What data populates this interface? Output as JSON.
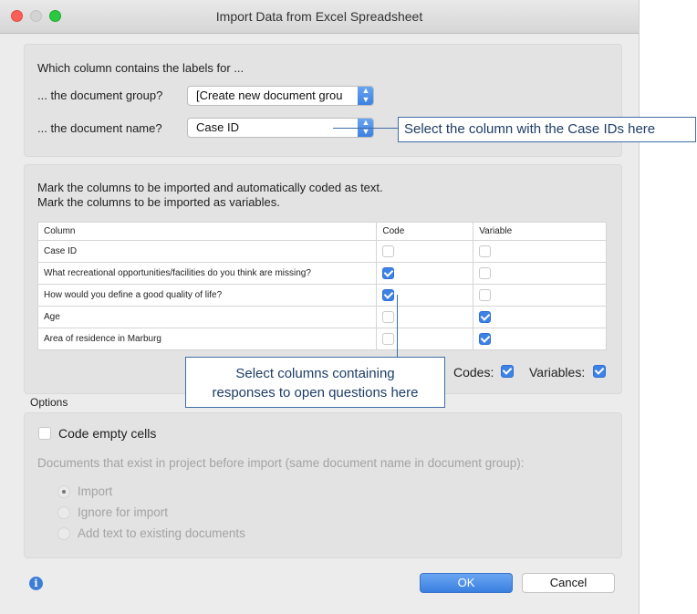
{
  "window": {
    "title": "Import Data from Excel Spreadsheet"
  },
  "labels_section": {
    "heading": "Which column contains the labels for ...",
    "group_label": "... the document group?",
    "group_value": "[Create new document grou",
    "name_label": "... the document name?",
    "name_value": "Case ID"
  },
  "annotations": {
    "case_id_callout": "Select the column with the Case IDs here",
    "open_questions_callout_line1": "Select columns containing",
    "open_questions_callout_line2": "responses to open questions here"
  },
  "columns_section": {
    "instruction_line1": "Mark the columns to be imported and automatically coded as text.",
    "instruction_line2": "Mark the columns to be imported as variables.",
    "headers": [
      "Column",
      "Code",
      "Variable"
    ],
    "rows": [
      {
        "name": "Case ID",
        "code": false,
        "variable": false
      },
      {
        "name": "What recreational opportunities/facilities do you think are missing?",
        "code": true,
        "variable": false
      },
      {
        "name": "How would you define a good quality of life?",
        "code": true,
        "variable": false
      },
      {
        "name": "Age",
        "code": false,
        "variable": true
      },
      {
        "name": "Area of residence in Marburg",
        "code": false,
        "variable": true
      }
    ],
    "codes_label": "Codes:",
    "codes_checked": true,
    "variables_label": "Variables:",
    "variables_checked": true
  },
  "options": {
    "heading": "Options",
    "code_empty_cells": "Code empty cells",
    "code_empty_cells_checked": false,
    "existing_docs_label": "Documents that exist in project before import (same document name in document group):",
    "radio_options": [
      "Import",
      "Ignore for import",
      "Add text to existing documents"
    ],
    "selected_radio": "Import"
  },
  "buttons": {
    "ok": "OK",
    "cancel": "Cancel"
  },
  "colors": {
    "accent": "#3e82e6",
    "callout_border": "#3f6da6"
  }
}
